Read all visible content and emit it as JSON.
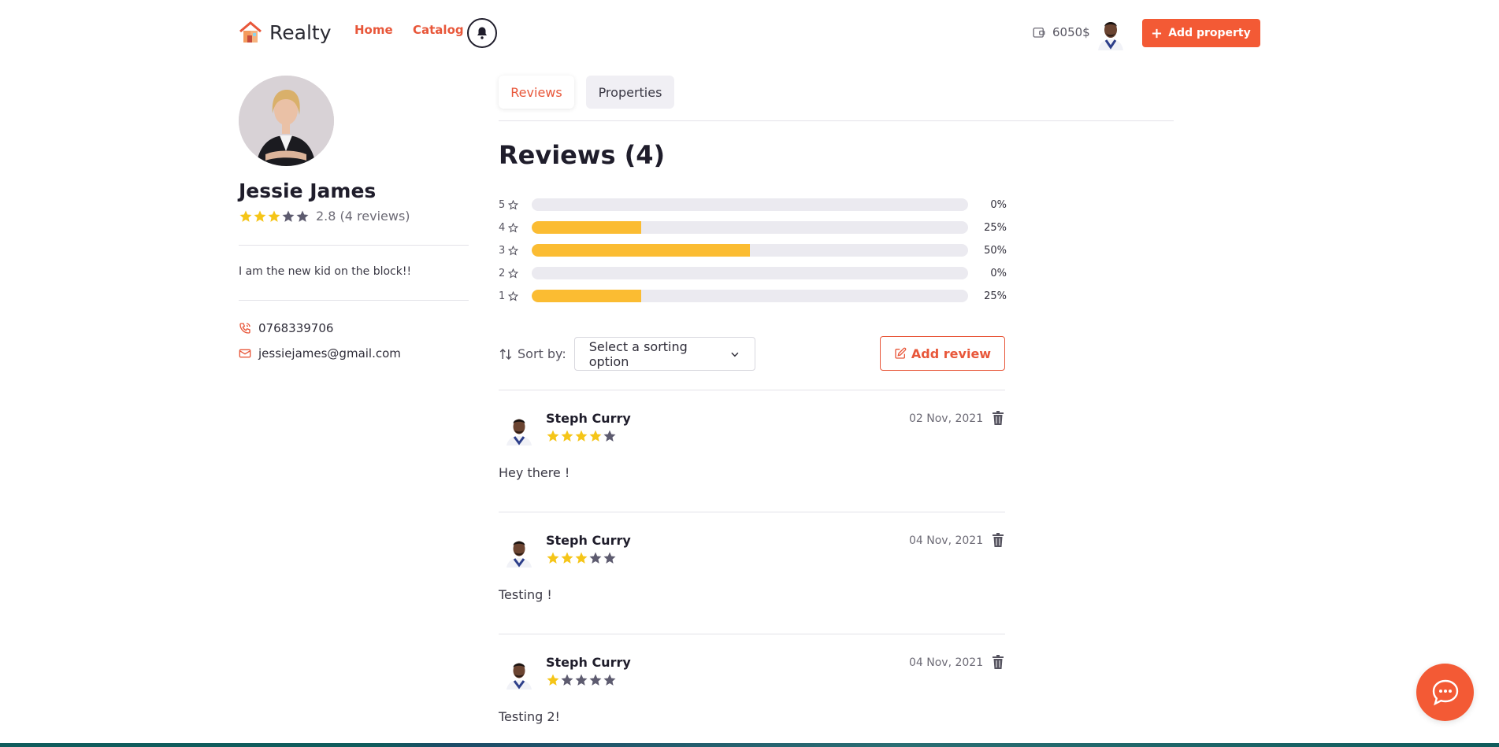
{
  "header": {
    "logo_text": "Realty",
    "nav": {
      "home": "Home",
      "catalog": "Catalog"
    },
    "wallet_balance": "6050$",
    "add_property_label": "Add property"
  },
  "profile": {
    "name": "Jessie James",
    "rating_value": 2.8,
    "rating_text": "2.8 (4 reviews)",
    "bio": "I am the new kid on the block!!",
    "phone": "0768339706",
    "email": "jessiejames@gmail.com"
  },
  "tabs": [
    {
      "label": "Reviews",
      "active": true
    },
    {
      "label": "Properties",
      "active": false
    }
  ],
  "reviews_section": {
    "title": "Reviews (4)",
    "distribution": [
      {
        "stars": "5",
        "percent": 0,
        "percent_label": "0%"
      },
      {
        "stars": "4",
        "percent": 25,
        "percent_label": "25%"
      },
      {
        "stars": "3",
        "percent": 50,
        "percent_label": "50%"
      },
      {
        "stars": "2",
        "percent": 0,
        "percent_label": "0%"
      },
      {
        "stars": "1",
        "percent": 25,
        "percent_label": "25%"
      }
    ],
    "sort_label": "Sort by:",
    "sort_placeholder": "Select a sorting option",
    "add_review_label": "Add review",
    "items": [
      {
        "author": "Steph Curry",
        "rating": 4,
        "date": "02 Nov, 2021",
        "text": "Hey there !"
      },
      {
        "author": "Steph Curry",
        "rating": 3,
        "date": "04 Nov, 2021",
        "text": "Testing !"
      },
      {
        "author": "Steph Curry",
        "rating": 1,
        "date": "04 Nov, 2021",
        "text": "Testing 2!"
      }
    ]
  },
  "colors": {
    "accent": "#f35a35",
    "link": "#e8573a",
    "star_filled": "#f5c518",
    "star_empty": "#5d5b6f",
    "bar_fill": "#fbbc32",
    "bar_track": "#ebeaf0"
  },
  "icons": {
    "logo": "house-logo-icon",
    "bell": "bell-icon",
    "wallet": "wallet-icon",
    "plus": "plus-icon",
    "phone": "phone-icon",
    "email": "mail-icon",
    "sort": "sort-arrows-icon",
    "chevron": "chevron-down-icon",
    "edit": "edit-icon",
    "trash": "trash-icon",
    "chat": "chat-bubble-icon"
  }
}
